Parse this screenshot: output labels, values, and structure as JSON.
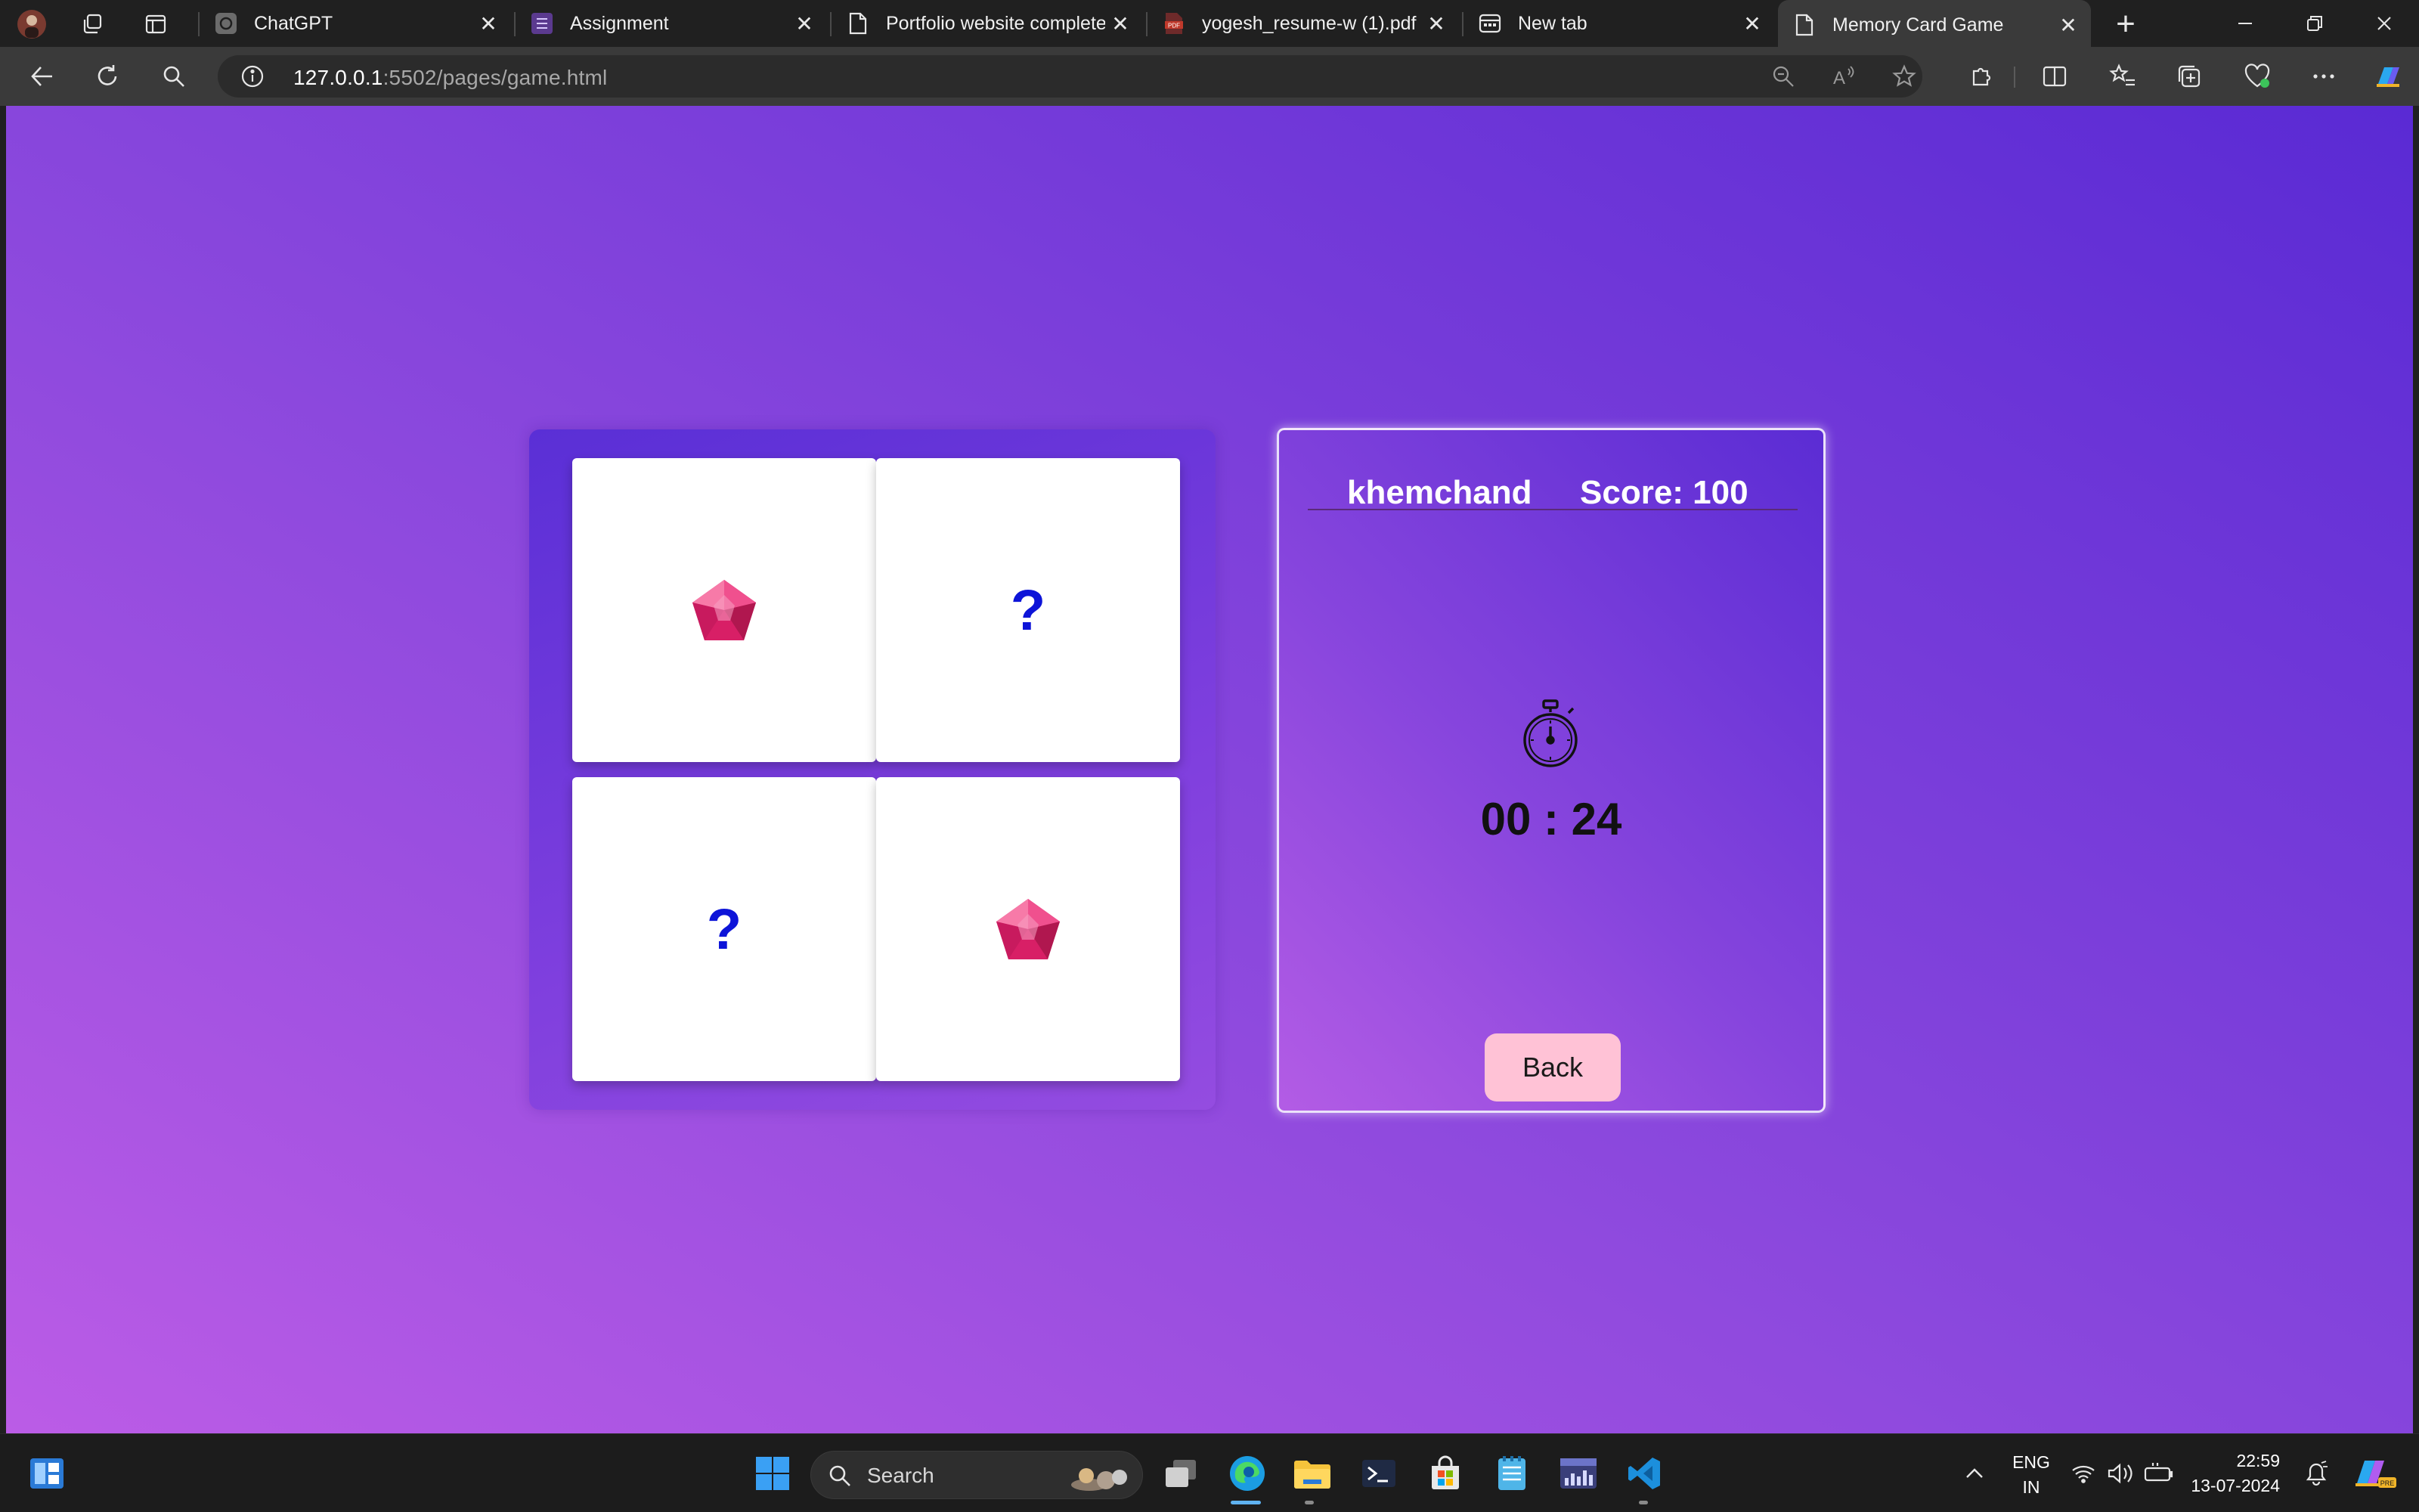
{
  "browser": {
    "tabs": [
      {
        "label": "ChatGPT",
        "icon": "chatgpt-icon"
      },
      {
        "label": "Assignment",
        "icon": "list-doc-icon"
      },
      {
        "label": "Portfolio website complete",
        "icon": "page-icon"
      },
      {
        "label": "yogesh_resume-w (1).pdf",
        "icon": "pdf-icon"
      },
      {
        "label": "New tab",
        "icon": "newtab-icon"
      },
      {
        "label": "Memory Card Game",
        "icon": "page-icon",
        "active": true
      }
    ],
    "close_glyph": "✕",
    "new_tab_glyph": "+",
    "url_host": "127.0.0.1",
    "url_rest": ":5502/pages/game.html"
  },
  "game": {
    "cards": [
      {
        "face": "gem",
        "symbol": ""
      },
      {
        "face": "hidden",
        "symbol": "?"
      },
      {
        "face": "hidden",
        "symbol": "?"
      },
      {
        "face": "gem",
        "symbol": ""
      }
    ],
    "player_name": "khemchand",
    "score_text": "Score: 100",
    "timer_text": "00 : 24",
    "back_label": "Back",
    "colors": {
      "gem": "#e0246e",
      "hidden_symbol": "#0d14d8",
      "back_button": "#ffc2d6"
    }
  },
  "taskbar": {
    "search_placeholder": "Search",
    "lang_top": "ENG",
    "lang_bottom": "IN",
    "time": "22:59",
    "date": "13-07-2024"
  }
}
